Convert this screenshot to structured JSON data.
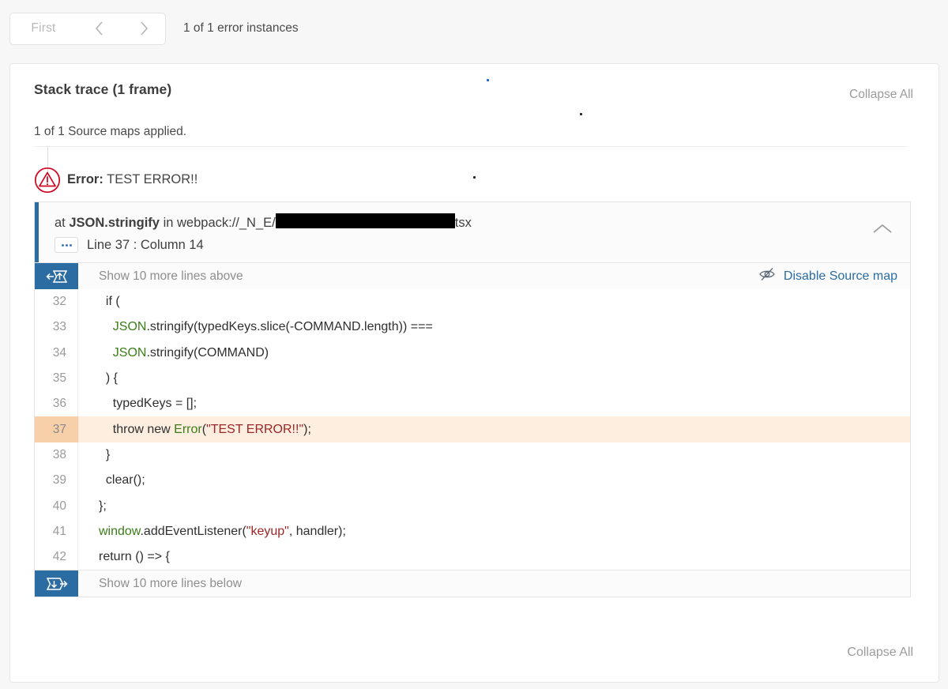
{
  "topbar": {
    "pager": {
      "first_label": "First",
      "prev_icon": "chevron-left-icon",
      "next_icon": "chevron-right-icon"
    },
    "instances_label": "1 of 1 error instances"
  },
  "card": {
    "stack_title": "Stack trace (1 frame)",
    "collapse_all_top": "Collapse All",
    "source_maps_status": "1 of 1 Source maps applied.",
    "error": {
      "icon": "error-triangle-icon",
      "label": "Error:",
      "message": "TEST ERROR!!"
    },
    "frame": {
      "at_prefix": "at",
      "function_name": "JSON.stringify",
      "in_word": "in",
      "file_prefix": "webpack://_N_E/",
      "file_suffix": "tsx",
      "path_redacted": true,
      "more_icon": "ellipsis-button",
      "location": "Line 37 : Column 14",
      "collapse_icon": "chevron-up-icon"
    },
    "code_top_bar": {
      "icon": "expand-up-icon",
      "label": "Show 10 more lines above",
      "action_icon": "eye-slash-icon",
      "action_label": "Disable Source map"
    },
    "code_bottom_bar": {
      "icon": "expand-down-icon",
      "label": "Show 10 more lines below"
    },
    "code_lines": [
      {
        "n": "32",
        "tokens": [
          {
            "t": "  if (",
            "c": ""
          }
        ]
      },
      {
        "n": "33",
        "tokens": [
          {
            "t": "    ",
            "c": ""
          },
          {
            "t": "JSON",
            "c": "tok-green"
          },
          {
            "t": ".stringify(typedKeys.slice(-COMMAND.length)) ===",
            "c": ""
          }
        ]
      },
      {
        "n": "34",
        "tokens": [
          {
            "t": "    ",
            "c": ""
          },
          {
            "t": "JSON",
            "c": "tok-green"
          },
          {
            "t": ".stringify(COMMAND)",
            "c": ""
          }
        ]
      },
      {
        "n": "35",
        "tokens": [
          {
            "t": "  ) {",
            "c": ""
          }
        ]
      },
      {
        "n": "36",
        "tokens": [
          {
            "t": "    typedKeys = [];",
            "c": ""
          }
        ]
      },
      {
        "n": "37",
        "hl": true,
        "tokens": [
          {
            "t": "    throw new ",
            "c": ""
          },
          {
            "t": "Error",
            "c": "tok-green"
          },
          {
            "t": "(",
            "c": ""
          },
          {
            "t": "\"TEST ERROR!!\"",
            "c": "tok-str"
          },
          {
            "t": ");",
            "c": ""
          }
        ]
      },
      {
        "n": "38",
        "tokens": [
          {
            "t": "  }",
            "c": ""
          }
        ]
      },
      {
        "n": "39",
        "tokens": [
          {
            "t": "  clear();",
            "c": ""
          }
        ]
      },
      {
        "n": "40",
        "tokens": [
          {
            "t": "};",
            "c": ""
          }
        ]
      },
      {
        "n": "41",
        "tokens": [
          {
            "t": "",
            "c": ""
          },
          {
            "t": "window",
            "c": "tok-green"
          },
          {
            "t": ".addEventListener(",
            "c": ""
          },
          {
            "t": "\"keyup\"",
            "c": "tok-str"
          },
          {
            "t": ", handler);",
            "c": ""
          }
        ]
      },
      {
        "n": "42",
        "tokens": [
          {
            "t": "return () => {",
            "c": ""
          }
        ]
      }
    ],
    "collapse_all_bottom": "Collapse All"
  },
  "colors": {
    "accent_blue": "#2b6ca3",
    "error_red": "#d0021b",
    "highlight_bg": "#fdeee0",
    "highlight_gutter": "#f7cfa9",
    "keyword_green": "#3a7d18",
    "string_red": "#9c2525"
  }
}
